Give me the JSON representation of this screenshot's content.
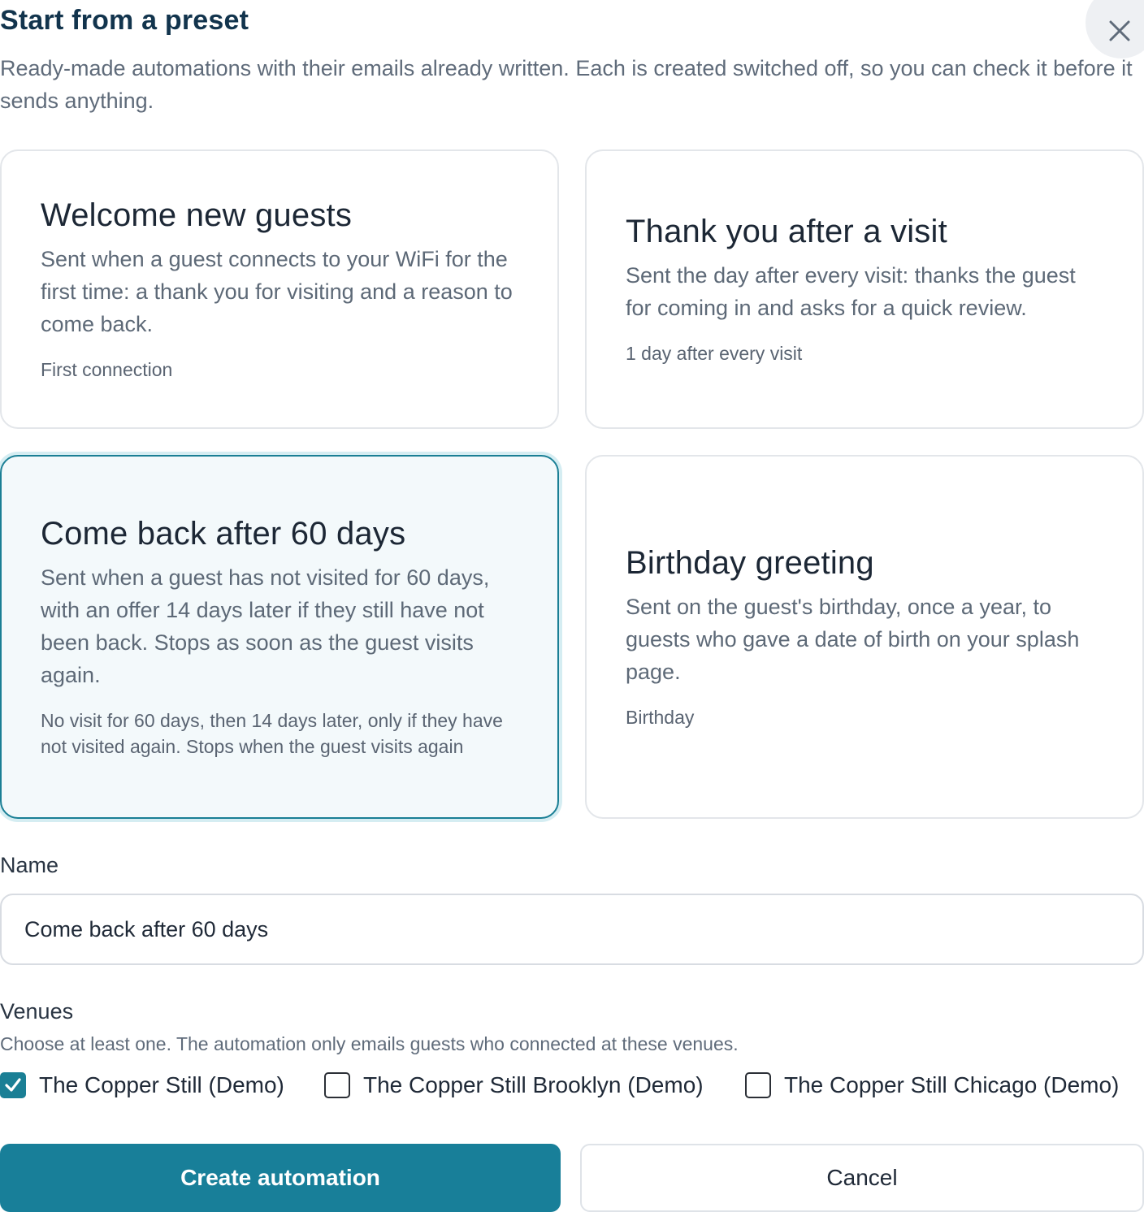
{
  "dialog": {
    "title": "Start from a preset",
    "subtitle": "Ready-made automations with their emails already written. Each is created switched off, so you can check it before it sends anything.",
    "close_icon": "close-icon"
  },
  "presets": [
    {
      "title": "Welcome new guests",
      "description": "Sent when a guest connects to your WiFi for the first time: a thank you for visiting and a reason to come back.",
      "trigger": "First connection",
      "selected": false
    },
    {
      "title": "Thank you after a visit",
      "description": "Sent the day after every visit: thanks the guest for coming in and asks for a quick review.",
      "trigger": "1 day after every visit",
      "selected": false
    },
    {
      "title": "Come back after 60 days",
      "description": "Sent when a guest has not visited for 60 days, with an offer 14 days later if they still have not been back. Stops as soon as the guest visits again.",
      "trigger": "No visit for 60 days, then 14 days later, only if they have not visited again. Stops when the guest visits again",
      "selected": true
    },
    {
      "title": "Birthday greeting",
      "description": "Sent on the guest's birthday, once a year, to guests who gave a date of birth on your splash page.",
      "trigger": "Birthday",
      "selected": false
    }
  ],
  "name_field": {
    "label": "Name",
    "value": "Come back after 60 days"
  },
  "venues": {
    "label": "Venues",
    "help": "Choose at least one. The automation only emails guests who connected at these venues.",
    "options": [
      {
        "label": "The Copper Still (Demo)",
        "checked": true
      },
      {
        "label": "The Copper Still Brooklyn (Demo)",
        "checked": false
      },
      {
        "label": "The Copper Still Chicago (Demo)",
        "checked": false
      }
    ]
  },
  "actions": {
    "create_label": "Create automation",
    "cancel_label": "Cancel"
  },
  "colors": {
    "accent": "#187f99",
    "title": "#12344d",
    "selected_card_bg": "#f3f9fb"
  }
}
